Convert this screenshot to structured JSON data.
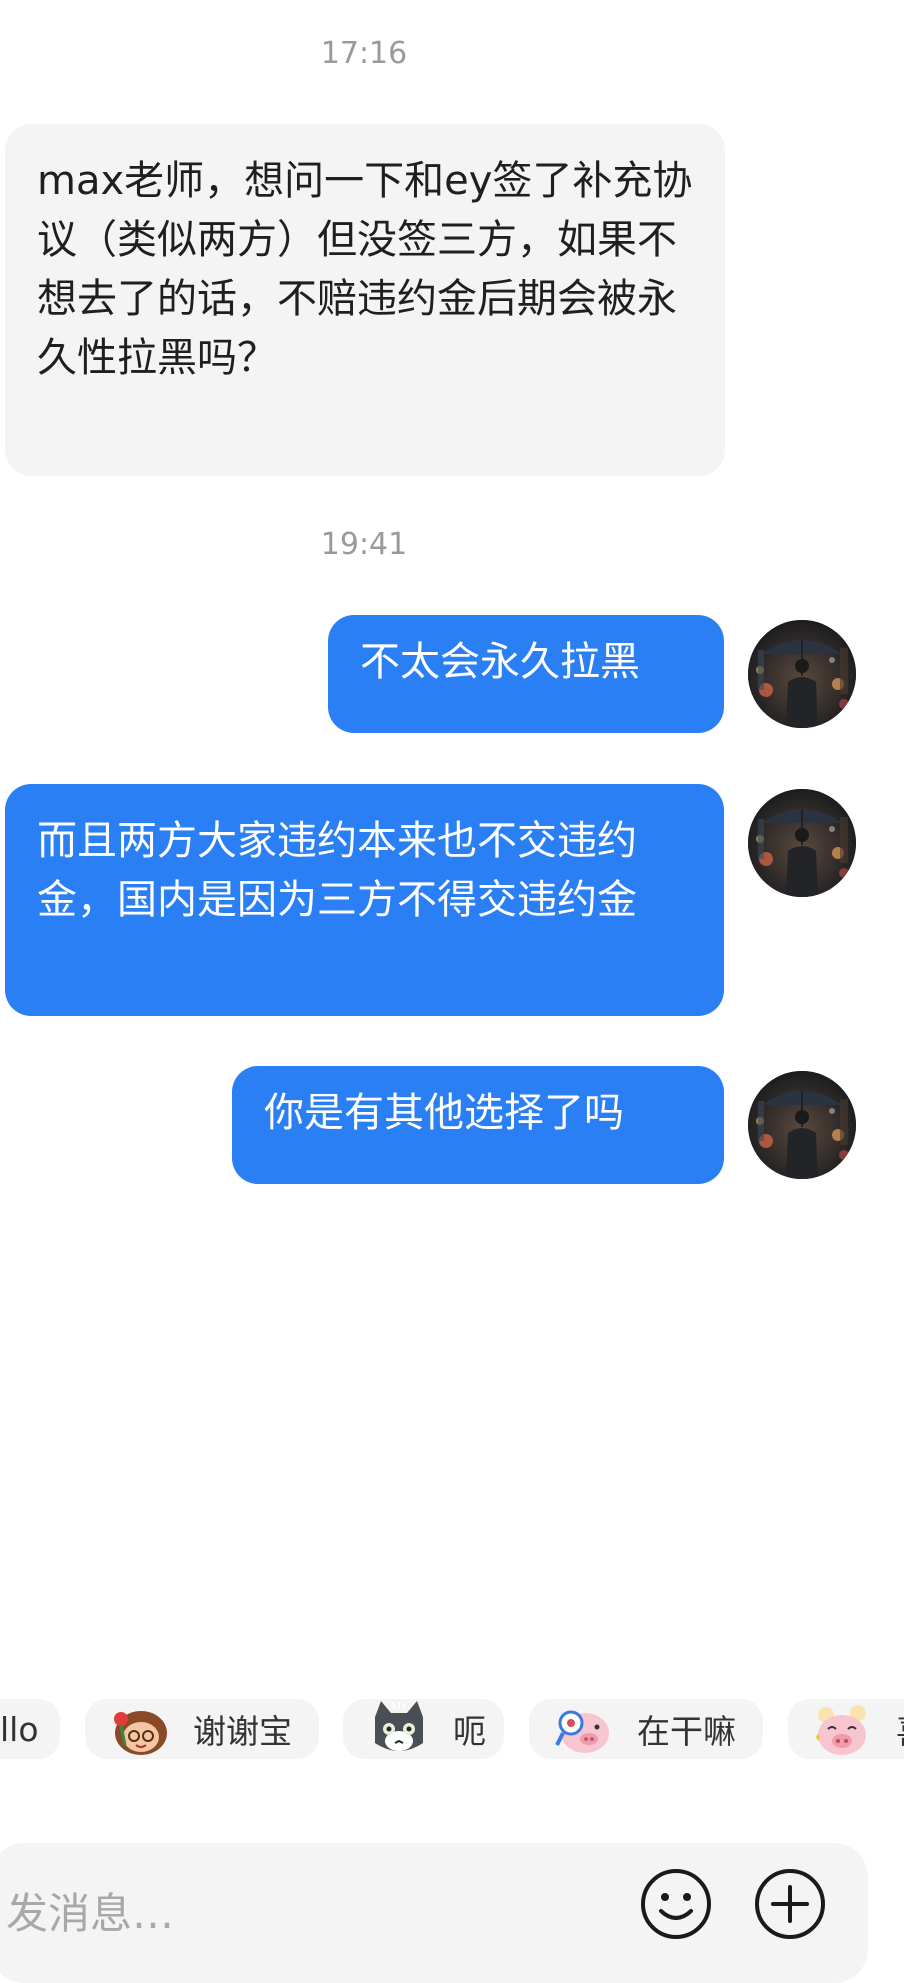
{
  "conversation": {
    "timestamps": [
      "17:16",
      "19:41"
    ],
    "messages": [
      {
        "direction": "in",
        "text": "max老师，想问一下和ey签了补充协议（类似两方）但没签三方，如果不想去了的话，不赔违约金后期会被永久性拉黑吗？"
      },
      {
        "direction": "out",
        "text": "不太会永久拉黑"
      },
      {
        "direction": "out",
        "text": "而且两方大家违约本来也不交违约金，国内是因为三方不得交违约金"
      },
      {
        "direction": "out",
        "text": "你是有其他选择了吗"
      }
    ]
  },
  "quick_replies": [
    {
      "label": "llo",
      "sticker": "greeting-sticker"
    },
    {
      "label": "谢谢宝",
      "sticker": "girl-with-rose-sticker"
    },
    {
      "label": "呃",
      "sticker": "gray-cat-sticker"
    },
    {
      "label": "在干嘛",
      "sticker": "pig-with-magnifier-sticker"
    },
    {
      "label": "喜",
      "sticker": "happy-pig-sticker"
    }
  ],
  "composer": {
    "placeholder": "发消息…",
    "emoji_button": "emoji-icon",
    "add_button": "plus-icon"
  },
  "colors": {
    "outgoing_bubble": "#2b7ff5",
    "incoming_bubble": "#f4f4f4",
    "timestamp": "#9a9a9a"
  }
}
